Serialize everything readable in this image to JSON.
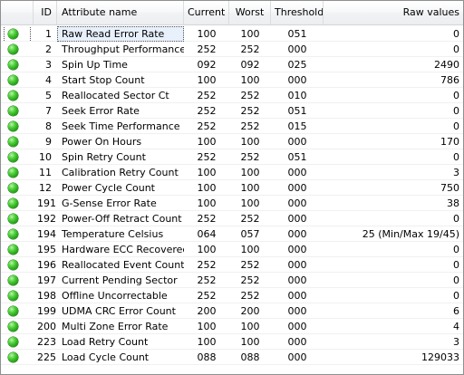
{
  "columns": {
    "id": "ID",
    "name": "Attribute name",
    "current": "Current",
    "worst": "Worst",
    "threshold": "Threshold",
    "raw": "Raw values"
  },
  "status_color": "#2fb51c",
  "selected_row": 0,
  "rows": [
    {
      "id": "1",
      "name": "Raw Read Error Rate",
      "current": "100",
      "worst": "100",
      "threshold": "051",
      "raw": "0",
      "status": "good"
    },
    {
      "id": "2",
      "name": "Throughput Performance",
      "current": "252",
      "worst": "252",
      "threshold": "000",
      "raw": "0",
      "status": "good"
    },
    {
      "id": "3",
      "name": "Spin Up Time",
      "current": "092",
      "worst": "092",
      "threshold": "025",
      "raw": "2490",
      "status": "good"
    },
    {
      "id": "4",
      "name": "Start Stop Count",
      "current": "100",
      "worst": "100",
      "threshold": "000",
      "raw": "786",
      "status": "good"
    },
    {
      "id": "5",
      "name": "Reallocated Sector Ct",
      "current": "252",
      "worst": "252",
      "threshold": "010",
      "raw": "0",
      "status": "good"
    },
    {
      "id": "7",
      "name": "Seek Error Rate",
      "current": "252",
      "worst": "252",
      "threshold": "051",
      "raw": "0",
      "status": "good"
    },
    {
      "id": "8",
      "name": "Seek Time Performance",
      "current": "252",
      "worst": "252",
      "threshold": "015",
      "raw": "0",
      "status": "good"
    },
    {
      "id": "9",
      "name": "Power On Hours",
      "current": "100",
      "worst": "100",
      "threshold": "000",
      "raw": "170",
      "status": "good"
    },
    {
      "id": "10",
      "name": "Spin Retry Count",
      "current": "252",
      "worst": "252",
      "threshold": "051",
      "raw": "0",
      "status": "good"
    },
    {
      "id": "11",
      "name": "Calibration Retry Count",
      "current": "100",
      "worst": "100",
      "threshold": "000",
      "raw": "3",
      "status": "good"
    },
    {
      "id": "12",
      "name": "Power Cycle Count",
      "current": "100",
      "worst": "100",
      "threshold": "000",
      "raw": "750",
      "status": "good"
    },
    {
      "id": "191",
      "name": "G-Sense Error Rate",
      "current": "100",
      "worst": "100",
      "threshold": "000",
      "raw": "38",
      "status": "good"
    },
    {
      "id": "192",
      "name": "Power-Off Retract Count",
      "current": "252",
      "worst": "252",
      "threshold": "000",
      "raw": "0",
      "status": "good"
    },
    {
      "id": "194",
      "name": "Temperature Celsius",
      "current": "064",
      "worst": "057",
      "threshold": "000",
      "raw": "25 (Min/Max 19/45)",
      "status": "good"
    },
    {
      "id": "195",
      "name": "Hardware ECC Recovered",
      "current": "100",
      "worst": "100",
      "threshold": "000",
      "raw": "0",
      "status": "good"
    },
    {
      "id": "196",
      "name": "Reallocated Event Count",
      "current": "252",
      "worst": "252",
      "threshold": "000",
      "raw": "0",
      "status": "good"
    },
    {
      "id": "197",
      "name": "Current Pending Sector",
      "current": "252",
      "worst": "252",
      "threshold": "000",
      "raw": "0",
      "status": "good"
    },
    {
      "id": "198",
      "name": "Offline Uncorrectable",
      "current": "252",
      "worst": "252",
      "threshold": "000",
      "raw": "0",
      "status": "good"
    },
    {
      "id": "199",
      "name": "UDMA CRC Error Count",
      "current": "200",
      "worst": "200",
      "threshold": "000",
      "raw": "6",
      "status": "good"
    },
    {
      "id": "200",
      "name": "Multi Zone Error Rate",
      "current": "100",
      "worst": "100",
      "threshold": "000",
      "raw": "4",
      "status": "good"
    },
    {
      "id": "223",
      "name": "Load Retry Count",
      "current": "100",
      "worst": "100",
      "threshold": "000",
      "raw": "3",
      "status": "good"
    },
    {
      "id": "225",
      "name": "Load Cycle Count",
      "current": "088",
      "worst": "088",
      "threshold": "000",
      "raw": "129033",
      "status": "good"
    }
  ]
}
